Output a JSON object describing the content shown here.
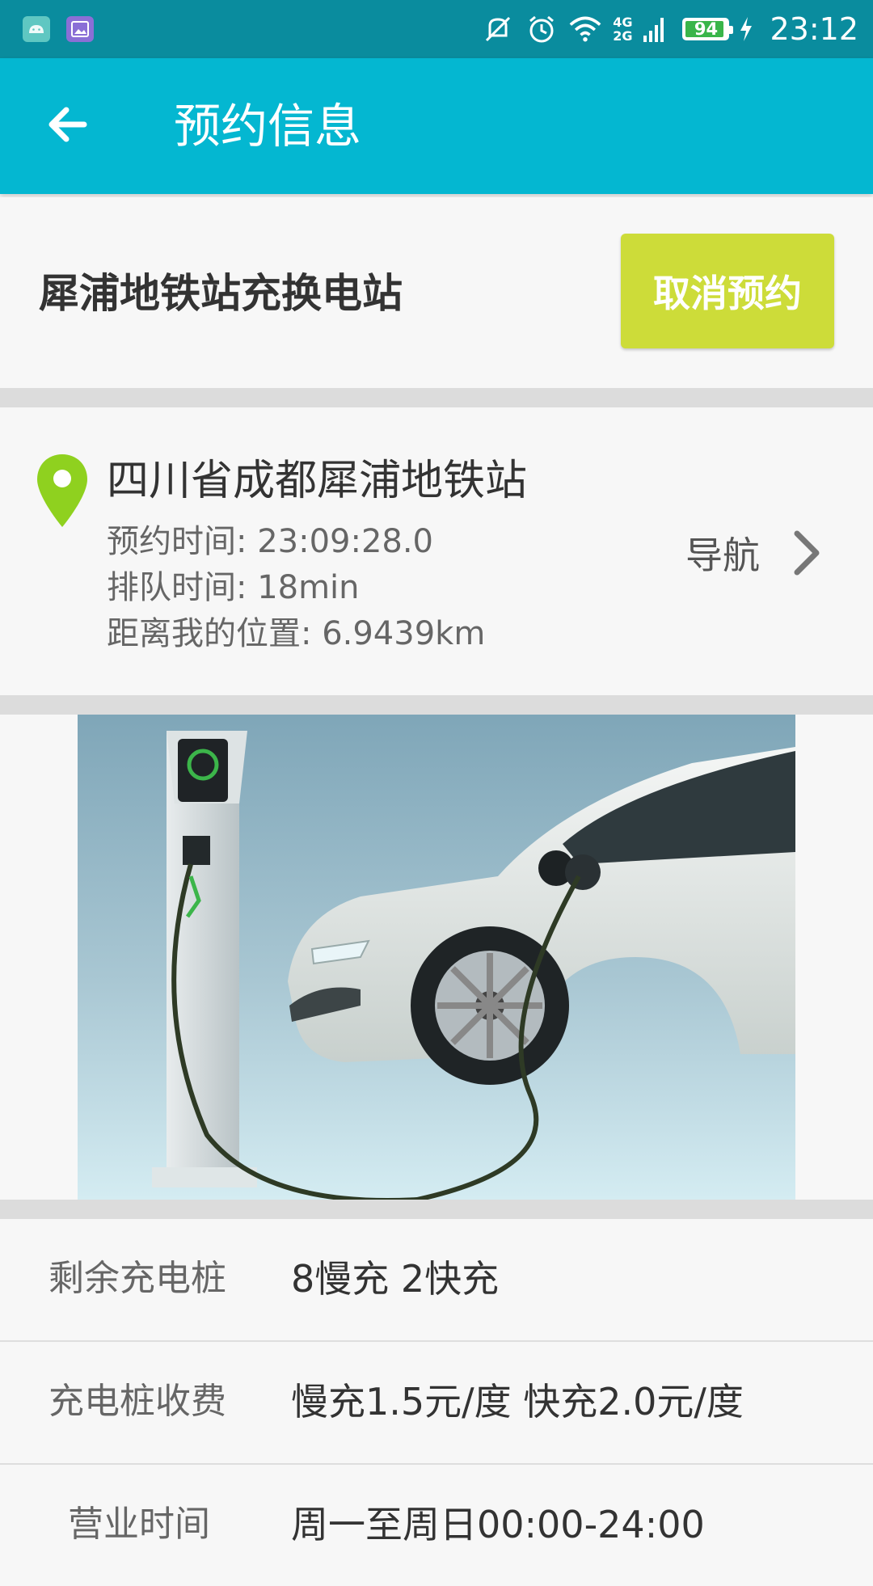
{
  "status_bar": {
    "time": "23:12",
    "battery_level": 94,
    "battery_text": "94",
    "net_top": "4G",
    "net_bottom": "2G",
    "icons": [
      "android-notification-icon",
      "gallery-notification-icon",
      "mute-icon",
      "alarm-icon",
      "wifi-icon",
      "signal-icon",
      "battery-icon",
      "charging-icon"
    ]
  },
  "appbar": {
    "title": "预约信息",
    "back_icon": "arrow-back-icon"
  },
  "station": {
    "name": "犀浦地铁站充换电站",
    "cancel_label": "取消预约",
    "cancel_color": "#cddc39"
  },
  "info": {
    "address": "四川省成都犀浦地铁站",
    "reserve_time": "预约时间: 23:09:28.0",
    "queue_time": "排队时间: 18min",
    "distance": "距离我的位置: 6.9439km",
    "nav_label": "导航",
    "pin_color": "#8fd11f"
  },
  "details": [
    {
      "label": "剩余充电桩",
      "value": "8慢充 2快充"
    },
    {
      "label": "充电桩收费",
      "value": "慢充1.5元/度 快充2.0元/度"
    },
    {
      "label": "营业时间",
      "value": "周一至周日00:00-24:00"
    }
  ],
  "colors": {
    "status_bar": "#0a8c9e",
    "app_bar": "#04b7d1",
    "background": "#f7f7f7",
    "separator": "#dcdcdc"
  }
}
